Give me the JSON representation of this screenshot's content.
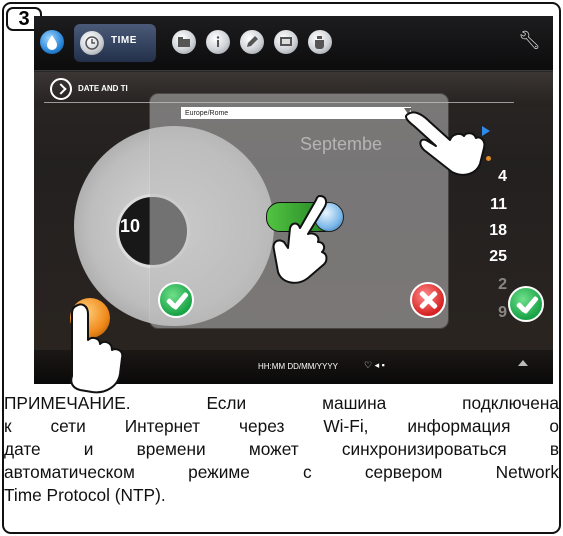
{
  "step": {
    "number": "3"
  },
  "toolbar": {
    "time_label": "TIME",
    "icons": [
      "water-drop-icon",
      "clock-icon",
      "folder-icon",
      "info-icon",
      "pencil-icon",
      "monitor-icon",
      "cup-icon",
      "wrench-icon"
    ]
  },
  "subheader": {
    "title": "DATE AND TI"
  },
  "dialog": {
    "timezone_value": "Europe/Rome",
    "faded_month": "Septembe",
    "toggle_state": "on"
  },
  "dial": {
    "value": "10"
  },
  "calendar": {
    "days": [
      "4",
      "11",
      "18",
      "25",
      "2",
      "9"
    ]
  },
  "statusbar": {
    "format_text": "HH:MM DD/MM/YYYY",
    "icons": "♡ ◂ ▪"
  },
  "colors": {
    "ok": "#19a347",
    "cancel": "#d62222",
    "accent_orange": "#f08a1a",
    "toggle_on": "#52c441"
  },
  "caption": {
    "line1": "ПРИМЕЧАНИЕ. Если машина подключена",
    "line2": "к сети Интернет через Wi-Fi, информация о",
    "line3": "дате и времени может синхронизироваться в",
    "line4": "автоматическом режиме с сервером Network",
    "line5": "Time Protocol (NTP)."
  }
}
